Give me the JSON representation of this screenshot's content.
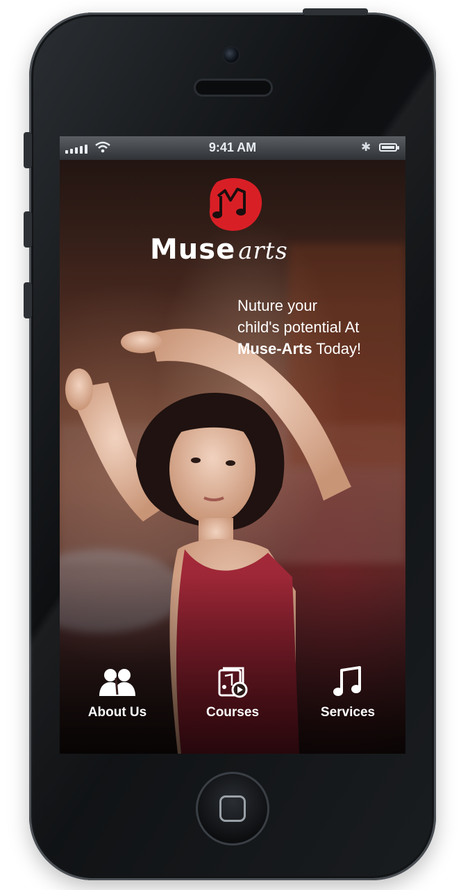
{
  "status_bar": {
    "time": "9:41 AM"
  },
  "brand": {
    "logo_word_1": "Muse",
    "logo_word_2": "arts",
    "accent_color": "#d91f26"
  },
  "hero": {
    "tagline_line_1": "Nuture your",
    "tagline_line_2": "child's potential At",
    "tagline_brand": "Muse-Arts",
    "tagline_end": " Today!"
  },
  "nav": {
    "items": [
      {
        "label": "About Us",
        "icon": "users-icon"
      },
      {
        "label": "Courses",
        "icon": "music-video-icon"
      },
      {
        "label": "Services",
        "icon": "music-note-icon"
      }
    ]
  }
}
